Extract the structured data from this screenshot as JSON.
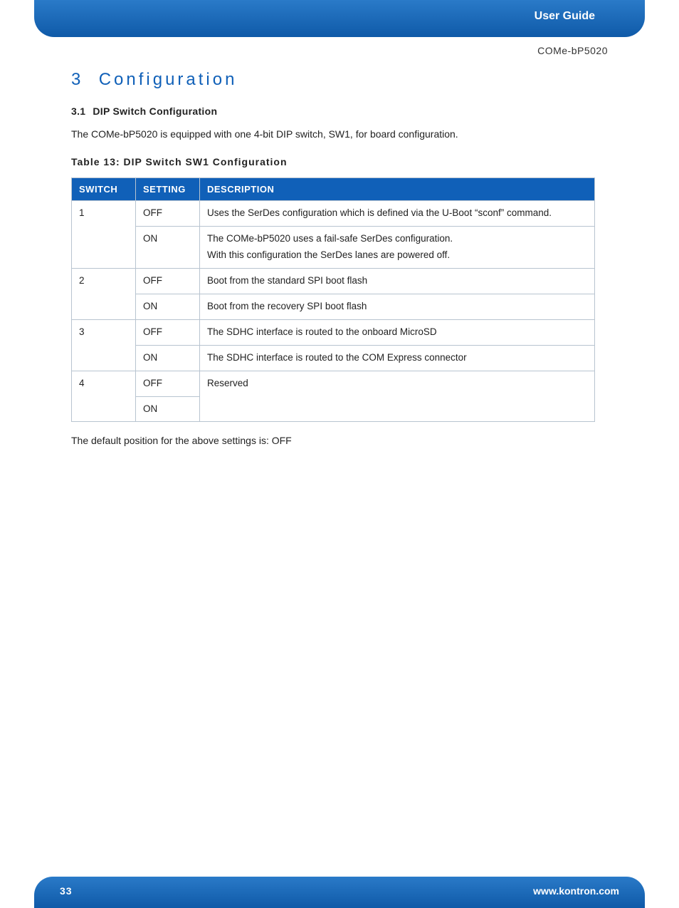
{
  "header": {
    "label": "User Guide",
    "product": "COMe-bP5020"
  },
  "section": {
    "num": "3",
    "title": "Configuration"
  },
  "subsection": {
    "num": "3.1",
    "title": "DIP Switch Configuration"
  },
  "body": {
    "intro": "The COMe-bP5020 is equipped with one 4-bit DIP switch, SW1, for board configuration.",
    "table_caption": "Table 13: DIP Switch SW1 Configuration",
    "footnote": "The default position for the above settings is: OFF"
  },
  "table": {
    "headers": {
      "switch": "SWITCH",
      "setting": "SETTING",
      "description": "DESCRIPTION"
    },
    "rows": [
      {
        "switch": "1",
        "setting": "OFF",
        "description": "Uses the SerDes configuration which is defined via the U-Boot “sconf” command."
      },
      {
        "switch": "",
        "setting": "ON",
        "description": "The COMe-bP5020 uses a fail-safe SerDes configuration.\nWith this configuration the SerDes lanes are powered off."
      },
      {
        "switch": "2",
        "setting": "OFF",
        "description": "Boot from the standard SPI boot flash"
      },
      {
        "switch": "",
        "setting": "ON",
        "description": "Boot from the recovery SPI boot flash"
      },
      {
        "switch": "3",
        "setting": "OFF",
        "description": "The SDHC interface is routed to the onboard MicroSD"
      },
      {
        "switch": "",
        "setting": "ON",
        "description": "The SDHC interface is routed to the COM Express connector"
      },
      {
        "switch": "4",
        "setting": "OFF",
        "description": "Reserved"
      },
      {
        "switch": "",
        "setting": "ON",
        "description": ""
      }
    ]
  },
  "footer": {
    "page": "33",
    "url": "www.kontron.com"
  }
}
